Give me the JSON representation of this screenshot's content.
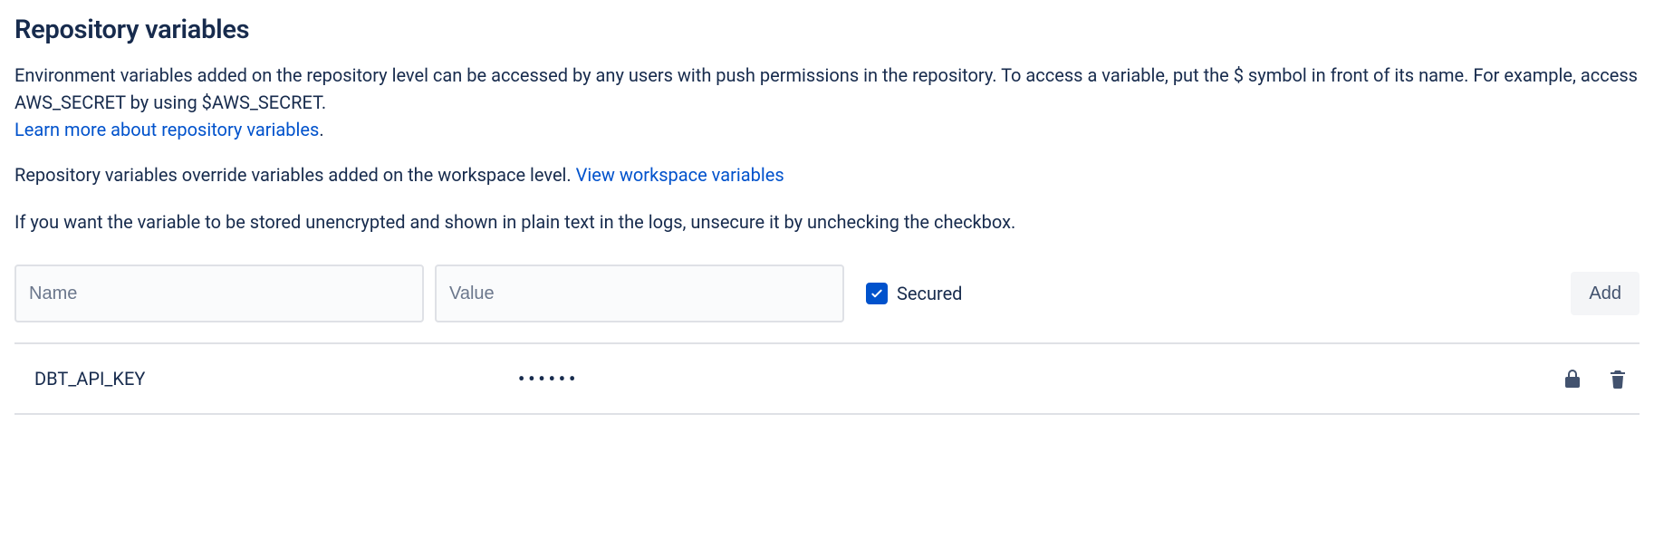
{
  "title": "Repository variables",
  "description": {
    "text1": "Environment variables added on the repository level can be accessed by any users with push permissions in the repository. To access a variable, put the $ symbol in front of its name. For example, access AWS_SECRET by using $AWS_SECRET.",
    "learn_more": "Learn more about repository variables",
    "period": "."
  },
  "override": {
    "text": "Repository variables override variables added on the workspace level. ",
    "link": "View workspace variables"
  },
  "unsecure_note": "If you want the variable to be stored unencrypted and shown in plain text in the logs, unsecure it by unchecking the checkbox.",
  "form": {
    "name_placeholder": "Name",
    "value_placeholder": "Value",
    "secured_label": "Secured",
    "secured_checked": true,
    "add_label": "Add"
  },
  "variables": [
    {
      "name": "DBT_API_KEY",
      "value_masked": "••••••",
      "secured": true
    }
  ]
}
